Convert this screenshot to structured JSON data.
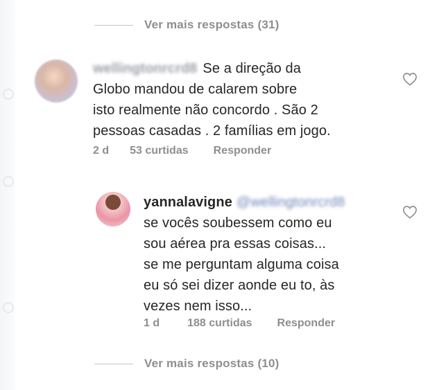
{
  "top_more_replies": {
    "label": "Ver mais respostas (31)"
  },
  "comment": {
    "username": "wellingtonrcrd8",
    "line1": "Se a direção da",
    "line2": "Globo mandou de calarem sobre",
    "line3": "isto realmente não concordo . São 2",
    "line4": "pessoas casadas . 2 famílias em jogo.",
    "time": "2 d",
    "likes": "53 curtidas",
    "reply": "Responder"
  },
  "reply": {
    "username": "yannalavigne",
    "mention": "@wellingtonrcrd8",
    "line1": "se vocês soubessem como eu",
    "line2": "sou aérea pra essas coisas...",
    "line3": "se me perguntam alguma coisa",
    "line4": "eu só sei dizer aonde eu to, às",
    "line5": "vezes nem isso...",
    "time": "1 d",
    "likes": "188 curtidas",
    "reply": "Responder"
  },
  "bottom_more_replies": {
    "label": "Ver mais respostas (10)"
  },
  "icons": {
    "like": "heart-outline-icon",
    "avatar_comment": "avatar",
    "avatar_reply": "avatar"
  },
  "colors": {
    "text": "#262626",
    "muted": "#8e8e8e",
    "divider": "#c7c7c7"
  }
}
